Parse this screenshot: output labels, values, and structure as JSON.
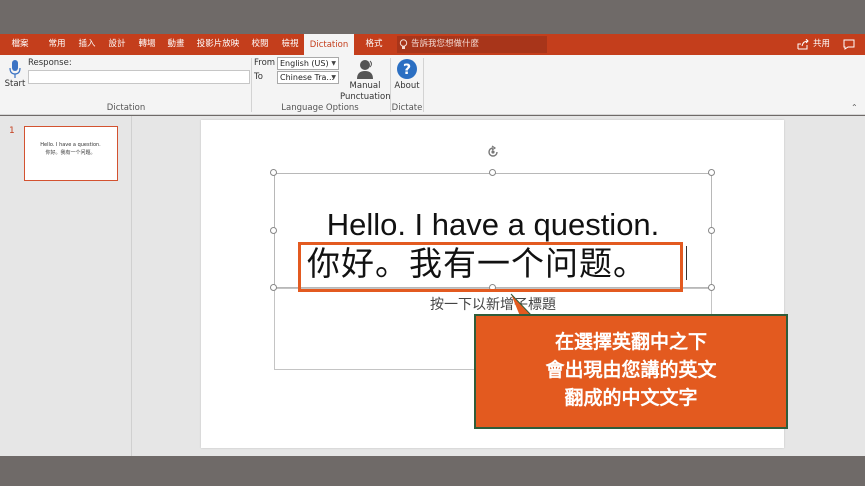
{
  "tabs": [
    {
      "label": "檔案",
      "active": false
    },
    {
      "label": "常用",
      "active": false
    },
    {
      "label": "插入",
      "active": false
    },
    {
      "label": "設計",
      "active": false
    },
    {
      "label": "轉場",
      "active": false
    },
    {
      "label": "動畫",
      "active": false
    },
    {
      "label": "投影片放映",
      "active": false
    },
    {
      "label": "校閱",
      "active": false
    },
    {
      "label": "檢視",
      "active": false
    },
    {
      "label": "Dictation",
      "active": true
    },
    {
      "label": "格式",
      "active": false
    }
  ],
  "tell_me": "告訴我您想做什麼",
  "share_label": "共用",
  "ribbon": {
    "start_label": "Start",
    "response_label": "Response:",
    "response_value": "",
    "dictation_group": "Dictation",
    "from_label": "From",
    "from_value": "English (US)",
    "to_label": "To",
    "to_value": "Chinese Tra...",
    "language_group": "Language Options",
    "manual_line1": "Manual",
    "manual_line2": "Punctuation",
    "about_label": "About",
    "dictate_group": "Dictate"
  },
  "thumbnail": {
    "number": "1",
    "line1": "Hello. I have a question.",
    "line2": "你好。我有一个问题。"
  },
  "slide": {
    "title_en": "Hello. I have a question.",
    "title_zh": "你好。我有一个问题。",
    "subtitle_placeholder": "按一下以新增子標題"
  },
  "callout": {
    "line1": "在選擇英翻中之下",
    "line2": "會出現由您講的英文",
    "line3": "翻成的中文文字"
  },
  "colors": {
    "accent": "#c43e1c",
    "callout": "#e35a1f",
    "callout_border": "#2f5d3a",
    "highlight": "#e35a20"
  }
}
